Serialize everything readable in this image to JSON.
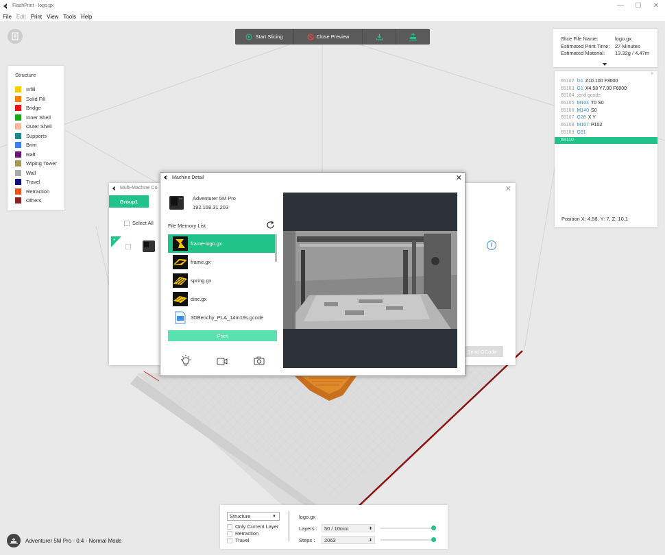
{
  "window": {
    "title": "FlashPrint - logo.gx",
    "controls": [
      "—",
      "☐",
      "✕"
    ]
  },
  "menu": [
    {
      "label": "File",
      "enabled": true
    },
    {
      "label": "Edit",
      "enabled": false
    },
    {
      "label": "Print",
      "enabled": true
    },
    {
      "label": "View",
      "enabled": true
    },
    {
      "label": "Tools",
      "enabled": true
    },
    {
      "label": "Help",
      "enabled": true
    }
  ],
  "toolbar": {
    "start_slicing": "Start Slicing",
    "close_preview": "Close Preview"
  },
  "legend": {
    "title": "Structure",
    "items": [
      {
        "label": "Infill",
        "color": "#f7d200"
      },
      {
        "label": "Solid Fill",
        "color": "#ff7f00"
      },
      {
        "label": "Bridge",
        "color": "#ee1111"
      },
      {
        "label": "Inner Shell",
        "color": "#18a818"
      },
      {
        "label": "Outer Shell",
        "color": "#f9b9a0"
      },
      {
        "label": "Supports",
        "color": "#1e8a8a"
      },
      {
        "label": "Brim",
        "color": "#3c82ef"
      },
      {
        "label": "Raft",
        "color": "#6c1570"
      },
      {
        "label": "Wiping Tower",
        "color": "#a29a55"
      },
      {
        "label": "Wall",
        "color": "#aaaaaa"
      },
      {
        "label": "Travel",
        "color": "#10107c"
      },
      {
        "label": "Retraction",
        "color": "#e8541d"
      },
      {
        "label": "Others",
        "color": "#8a2222"
      }
    ]
  },
  "slice_info": {
    "rows": [
      {
        "k": "Slice File Name:",
        "v": "logo.gx"
      },
      {
        "k": "Estimated Print Time:",
        "v": "27 Minutes"
      },
      {
        "k": "Estimated Material:",
        "v": "13.32g / 4.47m"
      }
    ]
  },
  "gcode": {
    "lines": [
      {
        "n": "65102",
        "cmd": "G1",
        "args": "Z10.100 F3000"
      },
      {
        "n": "65103",
        "cmd": "G1",
        "args": "X4.58 Y7.00 F6000"
      },
      {
        "n": "65104",
        "cmd": "",
        "args": ";end gcode",
        "comment": true
      },
      {
        "n": "65105",
        "cmd": "M104",
        "args": "T0 S0"
      },
      {
        "n": "65106",
        "cmd": "M140",
        "args": "S0"
      },
      {
        "n": "65107",
        "cmd": "G28",
        "args": "X Y"
      },
      {
        "n": "65108",
        "cmd": "M107",
        "args": "P102"
      },
      {
        "n": "65109",
        "cmd": "G91",
        "args": ""
      },
      {
        "n": "65110",
        "cmd": "",
        "args": "",
        "selected": true
      }
    ],
    "position": "Position   X: 4.58, Y: 7, Z: 10.1"
  },
  "multi_machine": {
    "title": "Multi-Machine Co",
    "tab": "Group1",
    "select_all": "Select All",
    "send_gcode": "Send GCode"
  },
  "machine_detail": {
    "title": "Machine Detail",
    "printer_name": "Adventurer 5M Pro",
    "printer_ip": "192.168.31.203",
    "file_memory_label": "File Memory List",
    "files": [
      {
        "name": "frame-logo.gx",
        "selected": true
      },
      {
        "name": "frame.gx",
        "selected": false
      },
      {
        "name": "spring.gx",
        "selected": false
      },
      {
        "name": "disc.gx",
        "selected": false
      },
      {
        "name": "3DBenchy_PLA_14m19s.gcode",
        "selected": false
      }
    ],
    "print_label": "Print"
  },
  "bottom_panel": {
    "view_mode": "Structure",
    "options": [
      "Only Current Layer",
      "Retraction",
      "Travel"
    ],
    "filename": "logo.gx",
    "layers_label": "Layers :",
    "layers_value": "50 / 10mm",
    "steps_label": "Steps :",
    "steps_value": "2063"
  },
  "status": {
    "text": "Adventurer 5M Pro - 0.4 - Normal Mode"
  },
  "accent_color": "#21c38a"
}
